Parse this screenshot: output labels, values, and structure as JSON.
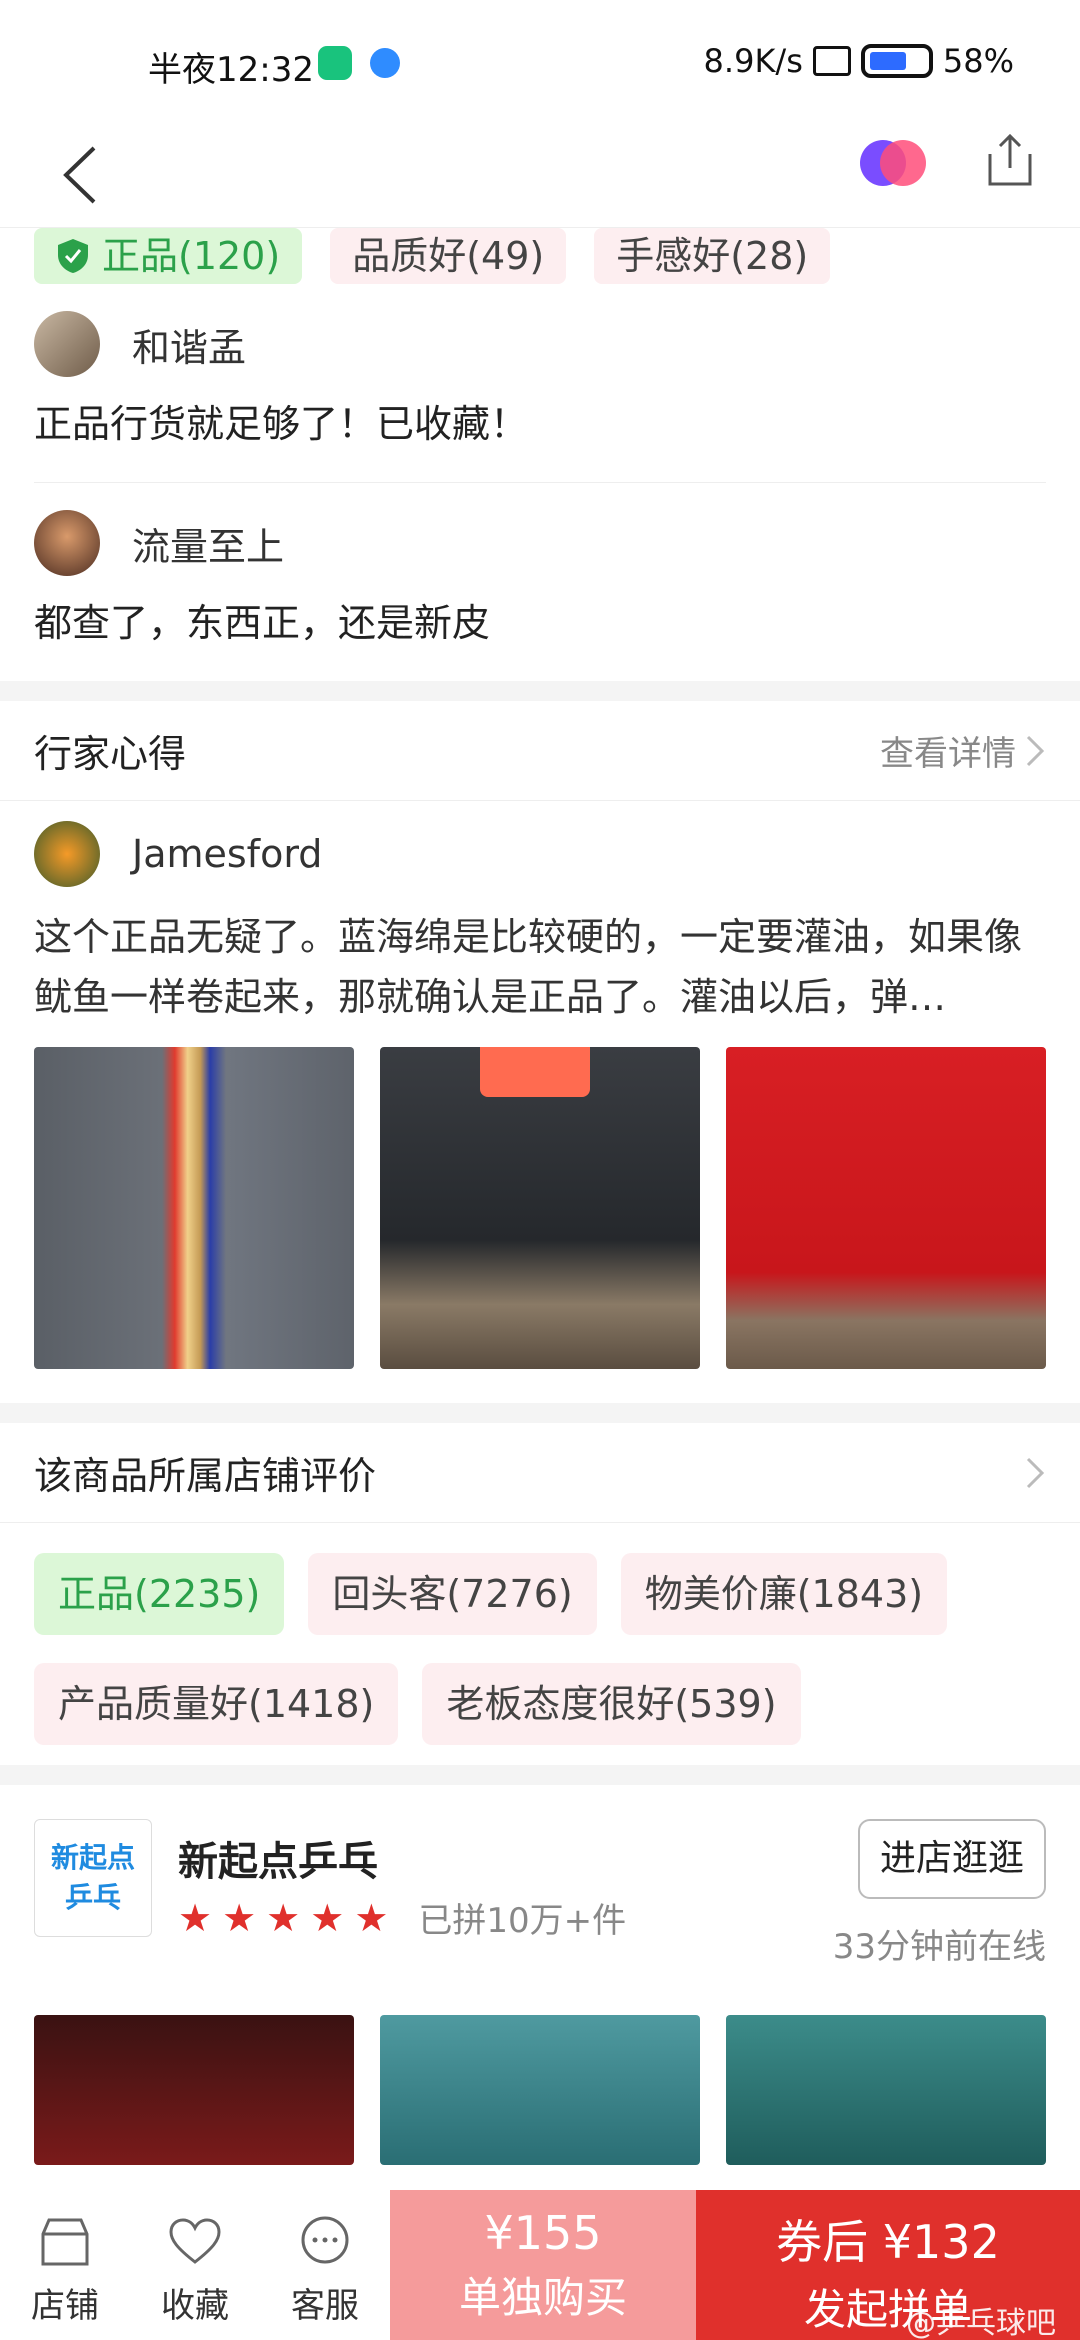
{
  "status_bar": {
    "time": "半夜12:32",
    "network": "8.9K/s",
    "battery": "58%"
  },
  "review_tags": [
    {
      "label": "正品(120)",
      "type": "green"
    },
    {
      "label": "品质好(49)",
      "type": "pink"
    },
    {
      "label": "手感好(28)",
      "type": "pink"
    }
  ],
  "reviews": [
    {
      "name": "和谐孟",
      "text": "正品行货就足够了！已收藏！"
    },
    {
      "name": "流量至上",
      "text": "都查了，东西正，还是新皮"
    }
  ],
  "expert": {
    "title": "行家心得",
    "link": "查看详情",
    "author": "Jamesford",
    "text": "这个正品无疑了。蓝海绵是比较硬的，一定要灌油，如果像鱿鱼一样卷起来，那就确认是正品了。灌油以后，弹…"
  },
  "store_review": {
    "title": "该商品所属店铺评价",
    "tags": [
      {
        "label": "正品(2235)",
        "type": "green"
      },
      {
        "label": "回头客(7276)",
        "type": "pink"
      },
      {
        "label": "物美价廉(1843)",
        "type": "pink"
      },
      {
        "label": "产品质量好(1418)",
        "type": "pink"
      },
      {
        "label": "老板态度很好(539)",
        "type": "pink"
      }
    ]
  },
  "store": {
    "logo_text_1": "新起点",
    "logo_text_2": "乒乓",
    "name": "新起点乒乓",
    "rating": 5,
    "sold": "已拼10万+件",
    "visit_button": "进店逛逛",
    "online": "33分钟前在线"
  },
  "bottom_bar": {
    "shop": "店铺",
    "favorite": "收藏",
    "service": "客服",
    "solo_price": "¥155",
    "solo_label": "单独购买",
    "group_price": "券后 ¥132",
    "group_label": "发起拼单",
    "watermark": "@乒乓球吧"
  },
  "colors": {
    "accent_red": "#e0302c",
    "light_red": "#f59b9b",
    "tag_green_bg": "#dcf7d7",
    "tag_green_text": "#2ba14a",
    "tag_pink_bg": "#fdeef0"
  }
}
